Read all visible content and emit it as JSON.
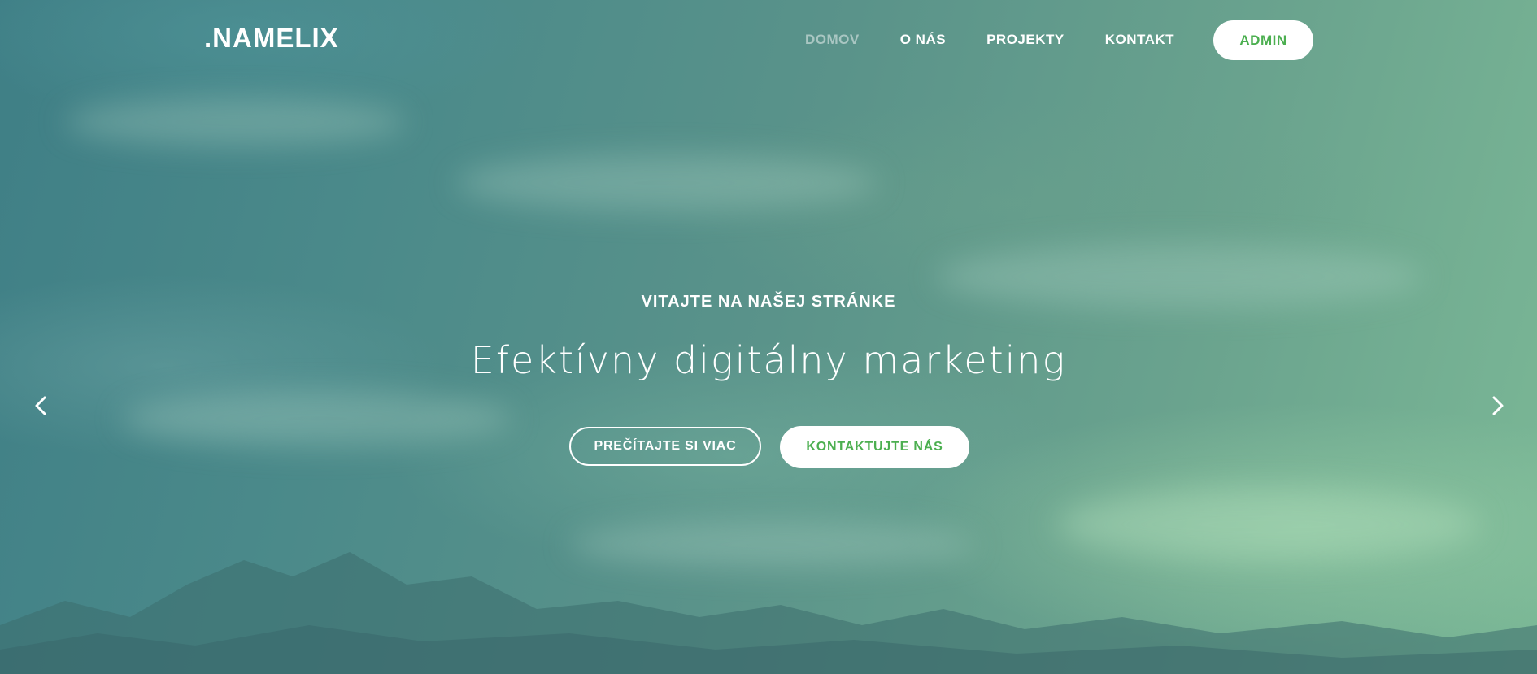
{
  "brand": {
    "logo": ".NAMELIX"
  },
  "nav": {
    "items": [
      {
        "label": "DOMOV",
        "active": true
      },
      {
        "label": "O NÁS",
        "active": false
      },
      {
        "label": "PROJEKTY",
        "active": false
      },
      {
        "label": "KONTAKT",
        "active": false
      }
    ],
    "admin_label": "ADMIN"
  },
  "hero": {
    "subtitle": "VITAJTE NA NAŠEJ STRÁNKE",
    "headline": "Efektívny digitálny marketing",
    "primary_button": "PREČÍTAJTE SI VIAC",
    "secondary_button": "KONTAKTUJTE NÁS"
  },
  "carousel": {
    "prev_icon": "chevron-left-icon",
    "next_icon": "chevron-right-icon"
  },
  "colors": {
    "accent": "#4caf50",
    "nav_active": "#a9c6c2",
    "text": "#ffffff"
  }
}
